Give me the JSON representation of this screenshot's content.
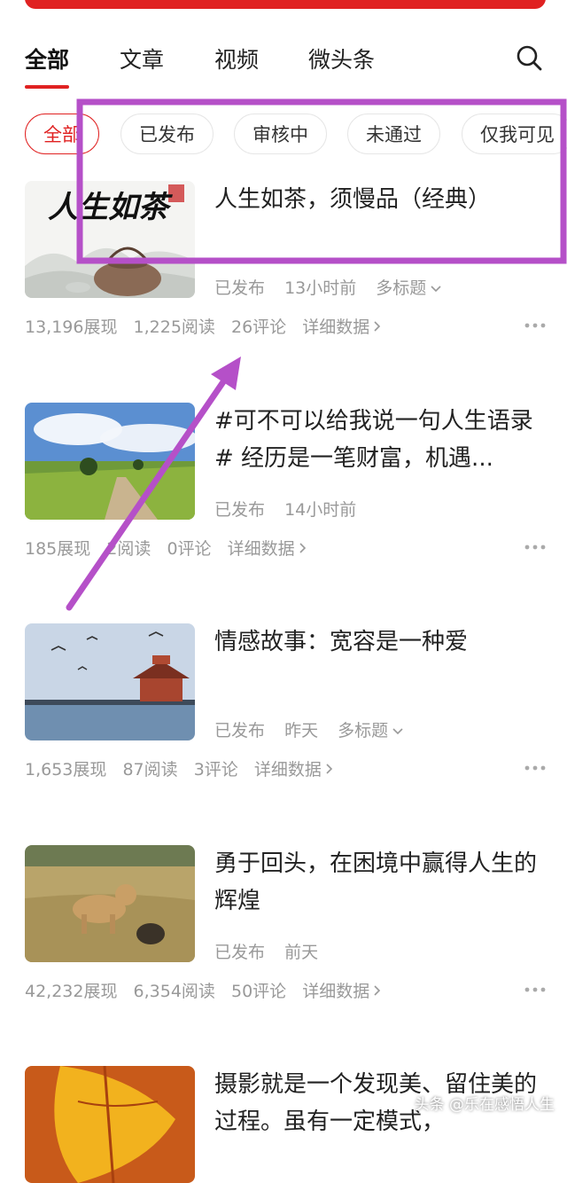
{
  "tabs": [
    "全部",
    "文章",
    "视频",
    "微头条"
  ],
  "filters": [
    "全部",
    "已发布",
    "审核中",
    "未通过",
    "仅我可见"
  ],
  "articles": [
    {
      "title": "人生如茶，须慢品（经典）",
      "thumb_text": "人生如茶",
      "status": "已发布",
      "time": "13小时前",
      "extra": "多标题",
      "views": "13,196展现",
      "reads": "1,225阅读",
      "comments": "26评论",
      "detail": "详细数据"
    },
    {
      "title": "#可不可以给我说一句人生语录# 经历是一笔财富，机遇...",
      "status": "已发布",
      "time": "14小时前",
      "extra": "",
      "views": "185展现",
      "reads": "2阅读",
      "comments": "0评论",
      "detail": "详细数据"
    },
    {
      "title": "情感故事：宽容是一种爱",
      "status": "已发布",
      "time": "昨天",
      "extra": "多标题",
      "views": "1,653展现",
      "reads": "87阅读",
      "comments": "3评论",
      "detail": "详细数据"
    },
    {
      "title": "勇于回头，在困境中赢得人生的辉煌",
      "status": "已发布",
      "time": "前天",
      "extra": "",
      "views": "42,232展现",
      "reads": "6,354阅读",
      "comments": "50评论",
      "detail": "详细数据"
    },
    {
      "title": "摄影就是一个发现美、留住美的过程。虽有一定模式，",
      "status": "",
      "time": "",
      "extra": "",
      "views": "",
      "reads": "",
      "comments": "",
      "detail": ""
    }
  ],
  "watermark": "头条 @乐在感悟人生",
  "colors": {
    "accent": "#e02222",
    "annotation": "#b550c8"
  },
  "icons": [
    "search-icon",
    "chevron-down-icon",
    "chevron-right-icon",
    "more-icon"
  ]
}
